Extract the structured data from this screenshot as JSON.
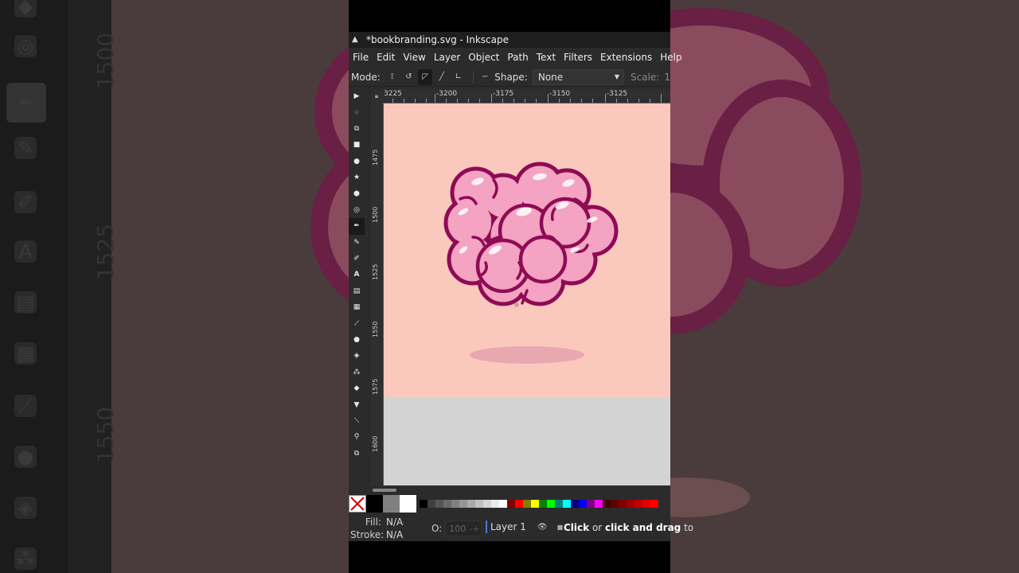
{
  "window": {
    "title": "*bookbranding.svg - Inkscape"
  },
  "menu": [
    "File",
    "Edit",
    "View",
    "Layer",
    "Object",
    "Path",
    "Text",
    "Filters",
    "Extensions",
    "Help"
  ],
  "tool_controls": {
    "mode_label": "Mode:",
    "shape_label": "Shape:",
    "shape_value": "None",
    "scale_label": "Scale:",
    "scale_value": "1"
  },
  "ruler": {
    "horizontal": [
      "3225",
      "-3200",
      "-3175",
      "-3150",
      "-3125"
    ],
    "vertical": [
      "1475",
      "1500",
      "1525",
      "1550",
      "1575",
      "1600"
    ]
  },
  "background_ruler": [
    "1500",
    "1525",
    "1550"
  ],
  "status": {
    "fill_label": "Fill:",
    "fill_value": "N/A",
    "stroke_label": "Stroke:",
    "stroke_value": "N/A",
    "opacity_label": "O:",
    "opacity_value": "100",
    "layer_name": "Layer 1",
    "message_bold1": "Click",
    "message_mid": " or ",
    "message_bold2": "click and drag",
    "message_end": " to"
  },
  "colors": {
    "page": "#fac8bd",
    "brain_fill": "#f4a3c2",
    "brain_stroke": "#8e0b55",
    "shadow": "#e8a8b0",
    "ui_dark": "#2b2b2b"
  },
  "palette": [
    "#000000",
    "#404040",
    "#555555",
    "#6a6a6a",
    "#808080",
    "#959595",
    "#aaaaaa",
    "#c0c0c0",
    "#d5d5d5",
    "#eaeaea",
    "#ffffff",
    "#800000",
    "#ff0000",
    "#808000",
    "#ffff00",
    "#008000",
    "#00ff00",
    "#008080",
    "#00ffff",
    "#000080",
    "#0000ff",
    "#800080",
    "#ff00ff",
    "#400000",
    "#600000",
    "#800000",
    "#a00000",
    "#c00000",
    "#e00000",
    "#ff0000"
  ]
}
